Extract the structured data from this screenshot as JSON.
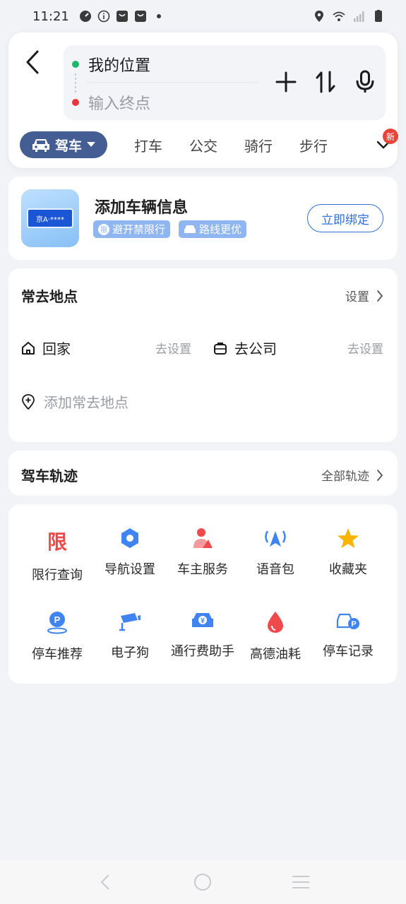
{
  "status_bar": {
    "time": "11:21"
  },
  "search": {
    "start_value": "我的位置",
    "end_placeholder": "输入终点"
  },
  "modes": {
    "active": "驾车",
    "items": [
      "打车",
      "公交",
      "骑行",
      "步行"
    ],
    "new_badge": "新"
  },
  "vehicle": {
    "plate_text": "京A·****",
    "title": "添加车辆信息",
    "tags": [
      "避开禁限行",
      "路线更优"
    ],
    "tag_icon_text": "限",
    "bind_label": "立即绑定"
  },
  "frequent": {
    "title": "常去地点",
    "settings_label": "设置",
    "home_label": "回家",
    "home_action": "去设置",
    "work_label": "去公司",
    "work_action": "去设置",
    "add_label": "添加常去地点"
  },
  "track": {
    "title": "驾车轨迹",
    "all_label": "全部轨迹"
  },
  "tools": {
    "restrict_glyph": "限",
    "row1": [
      "限行查询",
      "导航设置",
      "车主服务",
      "语音包",
      "收藏夹"
    ],
    "row2": [
      "停车推荐",
      "电子狗",
      "通行费助手",
      "高德油耗",
      "停车记录"
    ]
  },
  "colors": {
    "accent": "#2f6fd8",
    "mode_active_bg": "#445d92",
    "start_dot": "#1db86a",
    "end_dot": "#e8363a",
    "restrict_red": "#f0494b",
    "star_yellow": "#f7b500",
    "tool_blue": "#3f84f0"
  }
}
